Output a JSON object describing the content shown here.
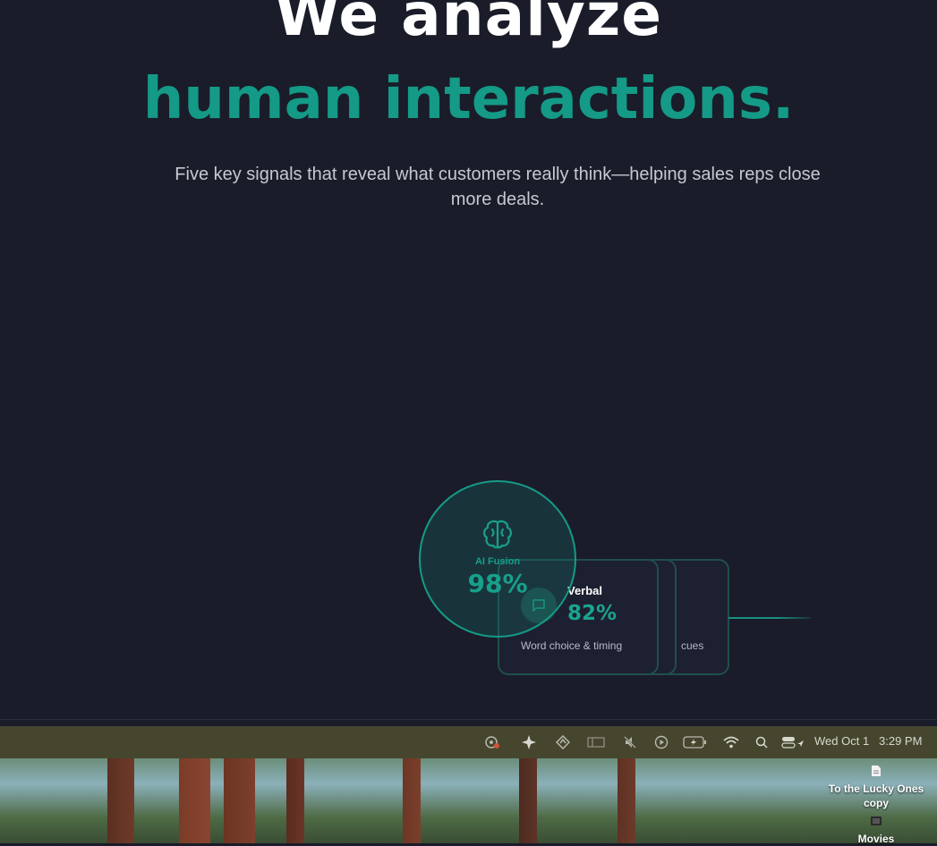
{
  "hero": {
    "line1": "We analyze",
    "line2": "human interactions.",
    "subtitle": "Five key signals that reveal what customers really think—helping sales reps close more deals."
  },
  "signals": {
    "fusion": {
      "label": "AI Fusion",
      "percent": "98%",
      "icon": "brain-icon"
    },
    "verbal": {
      "title": "Verbal",
      "percent": "82%",
      "description": "Word choice & timing",
      "icon": "chat-bubble-icon"
    },
    "hidden_card_text": "cues"
  },
  "menubar": {
    "icons": [
      "screen-record-icon",
      "sparkle-icon",
      "location-arrow-icon",
      "window-icon",
      "mute-icon",
      "play-icon",
      "battery-icon",
      "wifi-icon",
      "search-icon",
      "control-center-icon"
    ],
    "date": "Wed Oct 1",
    "time": "3:29 PM"
  },
  "desktop": {
    "items": [
      {
        "label": "To the Lucky Ones copy",
        "icon": "document-icon"
      },
      {
        "label": "Movies",
        "icon": "folder-icon"
      }
    ]
  },
  "colors": {
    "accent": "#149a87",
    "background": "#1a1c29"
  }
}
